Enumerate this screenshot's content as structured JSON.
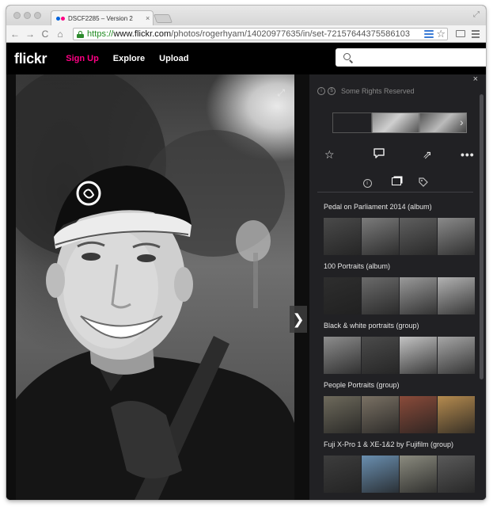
{
  "browser": {
    "tab_title": "DSCF2285 – Version 2",
    "tab_close": "×",
    "url_scheme": "https://",
    "url_host": "www.flickr.com",
    "url_path": "/photos/rogerhyam/14020977635/in/set-72157644375586103",
    "icons": {
      "back": "←",
      "forward": "→",
      "reload": "C",
      "home": "⌂",
      "star": "☆",
      "fullscreen": "⤢"
    }
  },
  "header": {
    "logo": "flickr",
    "nav": {
      "signup": "Sign Up",
      "explore": "Explore",
      "upload": "Upload"
    },
    "search_placeholder": ""
  },
  "photo": {
    "expand_icon": "⤢",
    "next_icon": "❯"
  },
  "panel": {
    "close_icon": "×",
    "cc_icon_1": "i",
    "cc_icon_2": "$",
    "rights": "Some Rights Reserved",
    "strip_chevron": "›",
    "actions": {
      "fave": "☆",
      "comment": "💬",
      "share": "⇗",
      "more": "•••"
    },
    "tabs": {
      "info": "i",
      "tags": "⌂"
    },
    "albums": [
      {
        "title": "Pedal on Parliament 2014 (album)",
        "thumb_colors": [
          "#4a4a4a",
          "#7b7b7b",
          "#5f5f5f",
          "#8a8a8a"
        ]
      },
      {
        "title": "100 Portraits (album)",
        "thumb_colors": [
          "#2e2e2e",
          "#6b6b6b",
          "#9a9a9a",
          "#b2b2b2"
        ]
      },
      {
        "title": "Black & white portraits (group)",
        "thumb_colors": [
          "#8d8d8d",
          "#4b4b4b",
          "#c3c3c3",
          "#a6a6a6"
        ]
      },
      {
        "title": "People Portraits (group)",
        "thumb_colors": [
          "#6e6a5c",
          "#7a7164",
          "#8a4b3a",
          "#b58b4f"
        ]
      },
      {
        "title": "Fuji X-Pro 1 & XE-1&2 by Fujifilm (group)",
        "thumb_colors": [
          "#3d3d3d",
          "#6a8fb0",
          "#8b8b7f",
          "#5a5a5a"
        ]
      }
    ]
  }
}
